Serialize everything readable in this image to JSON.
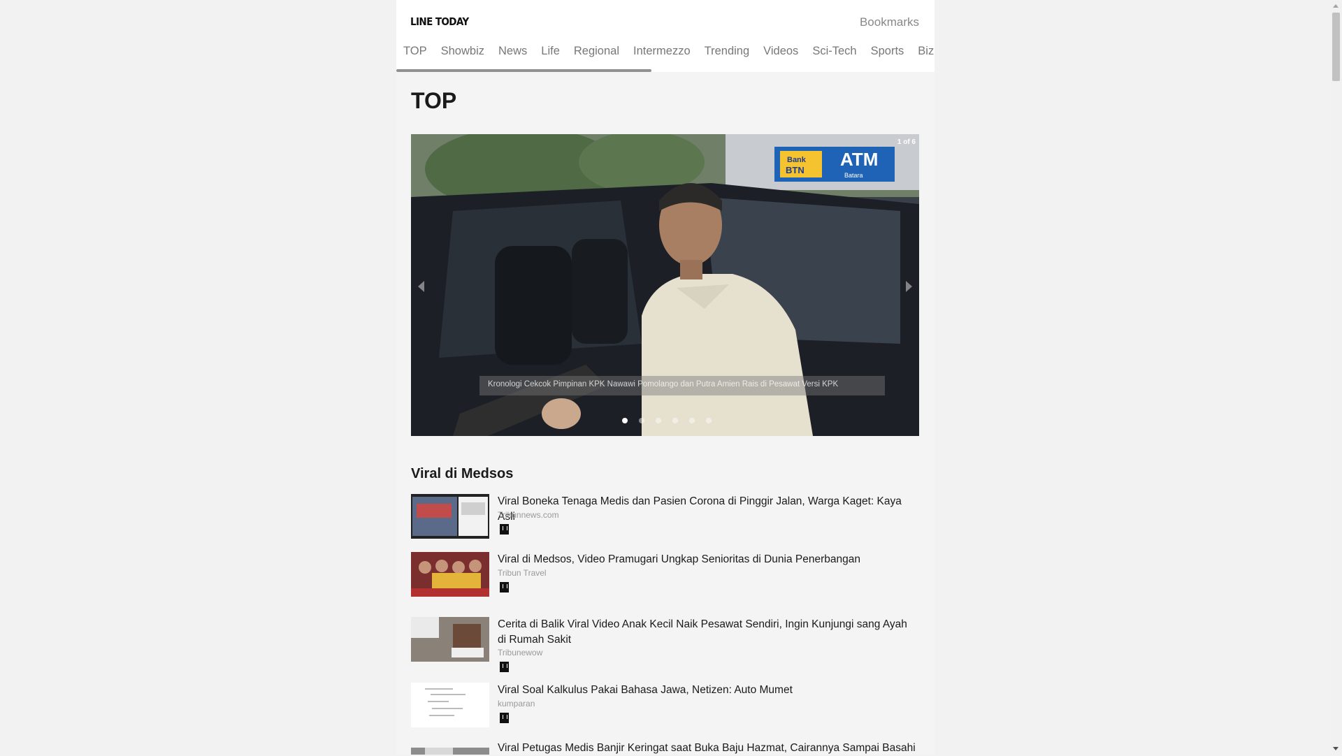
{
  "header": {
    "logo": "LINE TODAY",
    "bookmarks_label": "Bookmarks",
    "tabs": [
      "TOP",
      "Showbiz",
      "News",
      "Life",
      "Regional",
      "Intermezzo",
      "Trending",
      "Videos",
      "Sci-Tech",
      "Sports",
      "Biz"
    ],
    "active_tab": "TOP"
  },
  "main": {
    "title": "TOP",
    "carousel": {
      "counter": "1 of 6",
      "caption": "Kronologi Cekcok Pimpinan KPK Nawawi Pomolango dan Putra Amien Rais di Pesawat Versi KPK",
      "slide_count": 6,
      "active_slide": 1,
      "sign_bank": "Bank",
      "sign_btn": "BTN",
      "sign_atm": "ATM",
      "sign_sub": "Batara"
    },
    "section": {
      "title": "Viral di Medsos",
      "articles": [
        {
          "title": "Viral Boneka Tenaga Medis dan Pasien Corona di Pinggir Jalan, Warga Kaget: Kaya Asli",
          "source": "Tribunnews.com"
        },
        {
          "title": "Viral di Medsos, Video Pramugari Ungkap Senioritas di Dunia Penerbangan",
          "source": "Tribun Travel"
        },
        {
          "title": "Cerita di Balik Viral Video Anak Kecil Naik Pesawat Sendiri, Ingin Kunjungi sang Ayah di Rumah Sakit",
          "source": "Tribunewow"
        },
        {
          "title": "Viral Soal Kalkulus Pakai Bahasa Jawa, Netizen: Auto Mumet",
          "source": "kumparan"
        },
        {
          "title": "Viral Petugas Medis Banjir Keringat saat Buka Baju Hazmat, Cairannya Sampai Basahi",
          "source": ""
        }
      ]
    }
  },
  "colors": {
    "page_bg": "#f2f2f2",
    "content_bg": "#f4f4f4",
    "header_bg": "#ffffff",
    "tab_indicator": "#909090",
    "source_text": "#999999"
  },
  "icons": [
    "bookmark-icon",
    "chevron-left-icon",
    "chevron-right-icon"
  ]
}
